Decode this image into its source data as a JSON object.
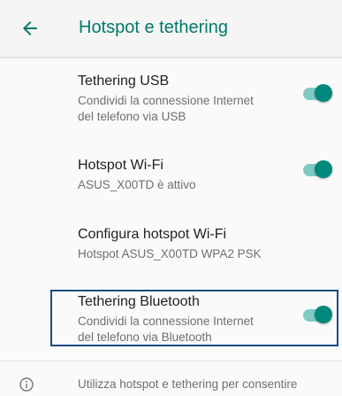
{
  "appbar": {
    "title": "Hotspot e tethering",
    "title_color": "#00796b"
  },
  "settings": [
    {
      "title": "Tethering USB",
      "subtitle": "Condividi la connessione Internet\ndel telefono via USB",
      "enabled": true
    },
    {
      "title": "Hotspot Wi-Fi",
      "subtitle": "ASUS_X00TD è attivo",
      "enabled": true
    },
    {
      "title": "Configura hotspot Wi-Fi",
      "subtitle": "Hotspot ASUS_X00TD WPA2 PSK"
    },
    {
      "title": "Tethering Bluetooth",
      "subtitle": "Condividi la connessione Internet\ndel telefono via Bluetooth",
      "enabled": true
    }
  ],
  "info": {
    "text": "Utilizza hotspot e tethering per consentire"
  },
  "colors": {
    "accent": "#00897b",
    "switch_track": "#80cbc4",
    "highlight_border": "#1d4b86"
  },
  "icons": {
    "back": "arrow-left-icon",
    "info": "info-circle-icon"
  }
}
